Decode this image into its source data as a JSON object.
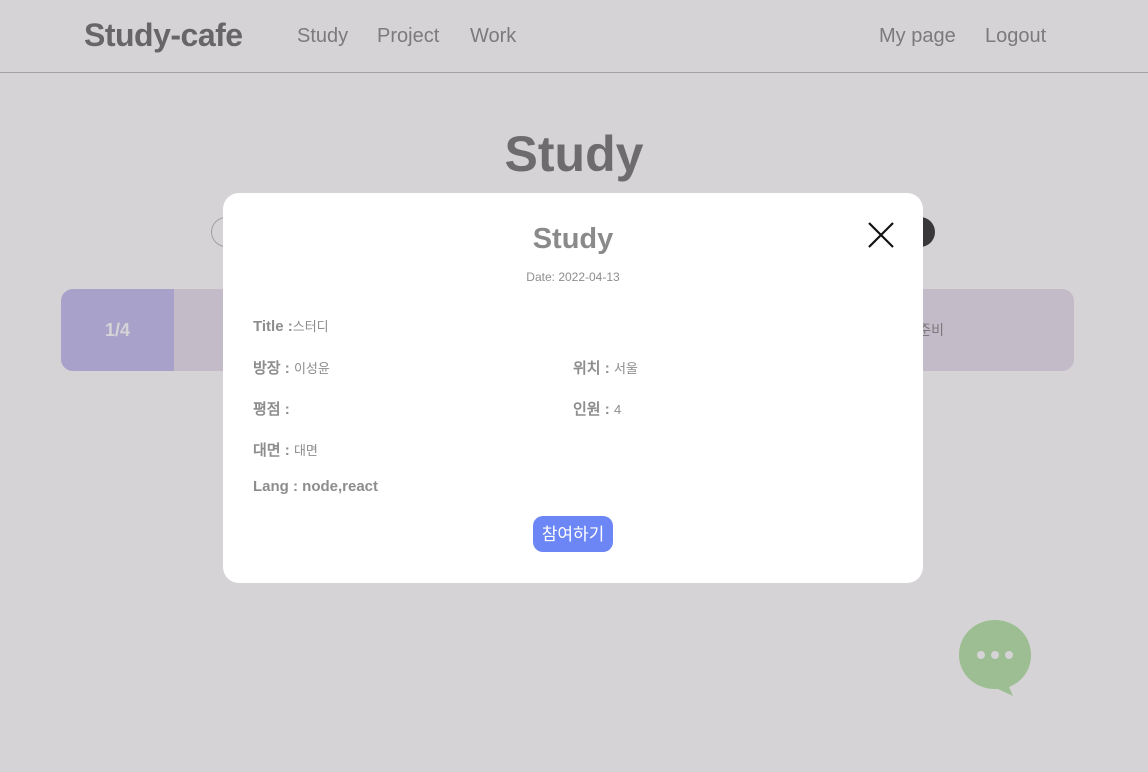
{
  "nav": {
    "brand": "Study-cafe",
    "links": [
      "Study",
      "Project",
      "Work"
    ],
    "right_links": [
      "My page",
      "Logout"
    ]
  },
  "page": {
    "title": "Study",
    "card": {
      "count": "1/4",
      "status": "준비"
    }
  },
  "modal": {
    "title": "Study",
    "date": "Date: 2022-04-13",
    "fields": {
      "title_label": "Title :",
      "title_value": "스터디",
      "leader_label": "방장 : ",
      "leader_value": "이성윤",
      "location_label": "위치 : ",
      "location_value": "서울",
      "rating_label": "평점 : ",
      "rating_value": "",
      "members_label": "인원 : ",
      "members_value": "4",
      "meet_label": "대면 : ",
      "meet_value": "대면",
      "lang": "Lang : node,react"
    },
    "join_label": "참여하기"
  },
  "colors": {
    "join_button": "#6c86f5",
    "card_count_bg": "#c4bff2",
    "card_bg": "#e9e0ee",
    "chat_button": "#b4e4a8"
  },
  "icons": [
    "close-icon",
    "chat-bubble-icon"
  ]
}
